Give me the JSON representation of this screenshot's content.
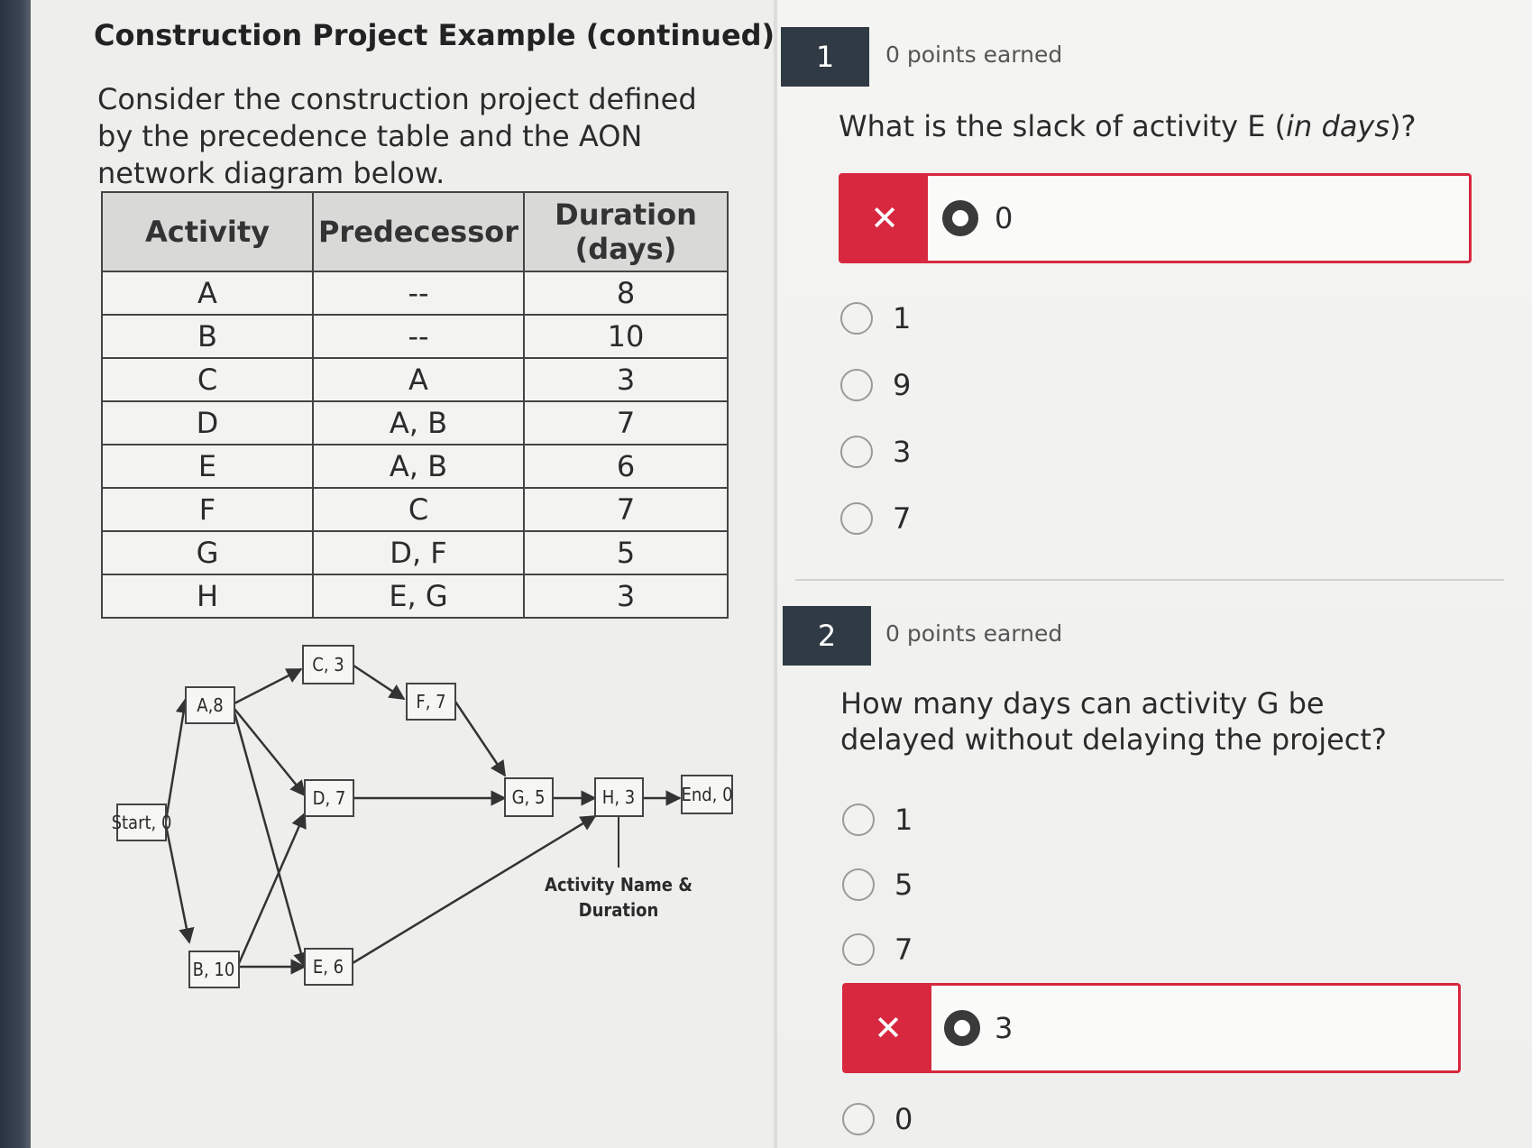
{
  "left": {
    "title": "Construction Project Example (continued)",
    "intro": "Consider the construction project defined by the precedence table and the AON network diagram below.",
    "table": {
      "headers": {
        "activity": "Activity",
        "predecessor": "Predecessor",
        "duration_line1": "Duration",
        "duration_line2": "(days)"
      },
      "rows": [
        {
          "activity": "A",
          "predecessor": "--",
          "duration": "8"
        },
        {
          "activity": "B",
          "predecessor": "--",
          "duration": "10"
        },
        {
          "activity": "C",
          "predecessor": "A",
          "duration": "3"
        },
        {
          "activity": "D",
          "predecessor": "A, B",
          "duration": "7"
        },
        {
          "activity": "E",
          "predecessor": "A, B",
          "duration": "6"
        },
        {
          "activity": "F",
          "predecessor": "C",
          "duration": "7"
        },
        {
          "activity": "G",
          "predecessor": "D, F",
          "duration": "5"
        },
        {
          "activity": "H",
          "predecessor": "E, G",
          "duration": "3"
        }
      ]
    },
    "network": {
      "nodes": {
        "start": "Start, 0",
        "a": "A,8",
        "b": "B, 10",
        "c": "C, 3",
        "d": "D, 7",
        "e": "E, 6",
        "f": "F, 7",
        "g": "G, 5",
        "h": "H, 3",
        "end": "End, 0"
      },
      "legend_line1": "Activity Name &",
      "legend_line2": "Duration"
    }
  },
  "questions": [
    {
      "number": "1",
      "points": "0 points earned",
      "text_before": "What is the slack of activity E (",
      "text_italic": "in days",
      "text_after": ")?",
      "selected": {
        "label": "0",
        "mark": "✕"
      },
      "options": [
        "1",
        "9",
        "3",
        "7"
      ]
    },
    {
      "number": "2",
      "points": "0 points earned",
      "text": "How many days can activity G be delayed without delaying the project?",
      "options": [
        "1",
        "5",
        "7"
      ],
      "selected": {
        "label": "3",
        "mark": "✕"
      },
      "options_after": [
        "0"
      ]
    }
  ],
  "colors": {
    "wrong": "#d7283f",
    "question_badge": "#2f3a44"
  }
}
